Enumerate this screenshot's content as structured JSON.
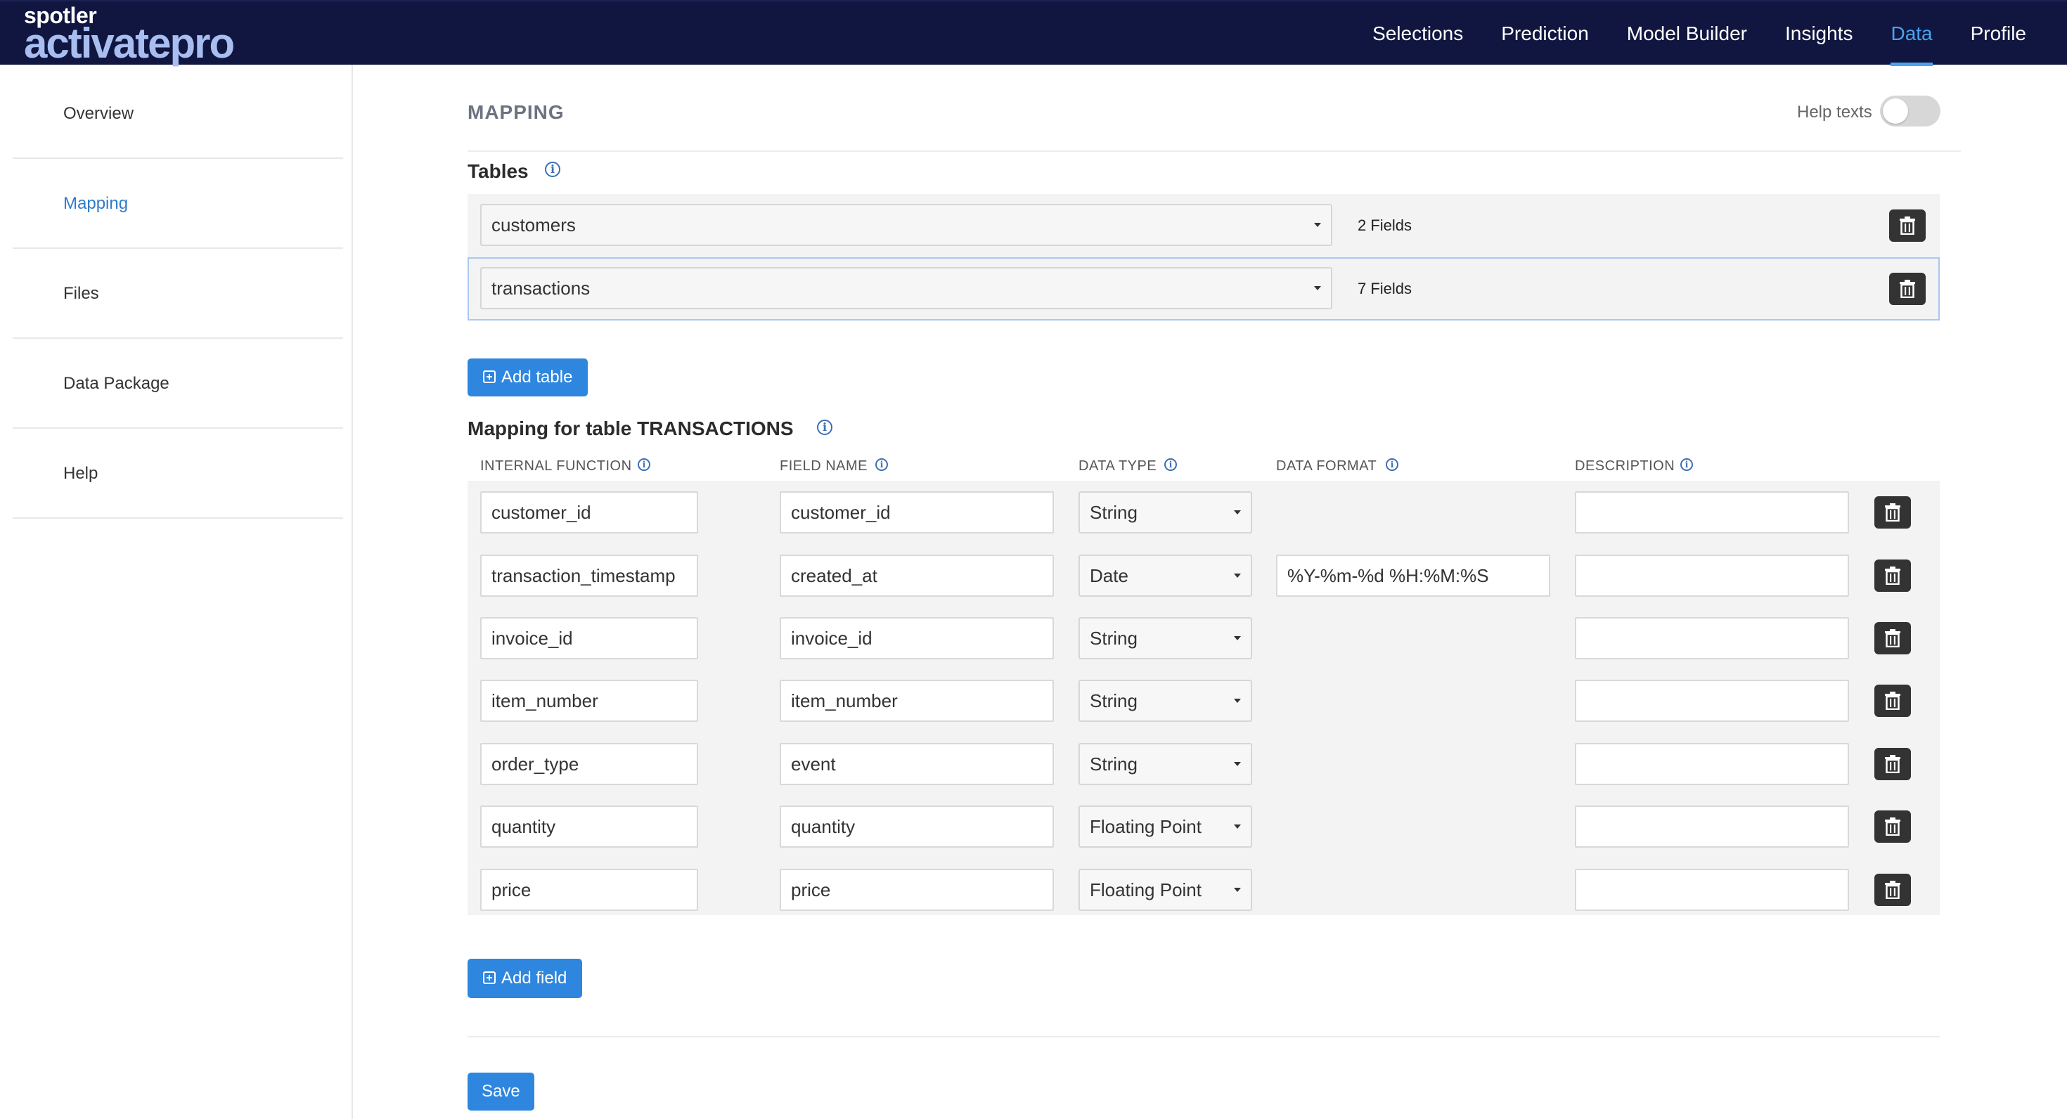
{
  "brand": {
    "top": "spotler",
    "name": "activatepro"
  },
  "nav": [
    {
      "label": "Selections",
      "active": false
    },
    {
      "label": "Prediction",
      "active": false
    },
    {
      "label": "Model Builder",
      "active": false
    },
    {
      "label": "Insights",
      "active": false
    },
    {
      "label": "Data",
      "active": true
    },
    {
      "label": "Profile",
      "active": false
    }
  ],
  "sidebar": [
    {
      "label": "Overview",
      "active": false
    },
    {
      "label": "Mapping",
      "active": true
    },
    {
      "label": "Files",
      "active": false
    },
    {
      "label": "Data Package",
      "active": false
    },
    {
      "label": "Help",
      "active": false
    }
  ],
  "page": {
    "title": "MAPPING",
    "help_texts_label": "Help texts",
    "help_texts_on": false
  },
  "tables_section": {
    "title": "Tables",
    "rows": [
      {
        "name": "customers",
        "fields": "2 Fields"
      },
      {
        "name": "transactions",
        "fields": "7 Fields",
        "selected": true
      }
    ],
    "add_label": "Add table"
  },
  "mapping_section": {
    "title": "Mapping for table TRANSACTIONS",
    "columns": [
      "INTERNAL FUNCTION",
      "FIELD NAME",
      "DATA TYPE",
      "DATA FORMAT",
      "DESCRIPTION"
    ],
    "rows": [
      {
        "internal": "customer_id",
        "field": "customer_id",
        "type": "String",
        "format": null,
        "description": ""
      },
      {
        "internal": "transaction_timestamp",
        "field": "created_at",
        "type": "Date",
        "format": "%Y-%m-%d %H:%M:%S",
        "description": ""
      },
      {
        "internal": "invoice_id",
        "field": "invoice_id",
        "type": "String",
        "format": null,
        "description": ""
      },
      {
        "internal": "item_number",
        "field": "item_number",
        "type": "String",
        "format": null,
        "description": ""
      },
      {
        "internal": "order_type",
        "field": "event",
        "type": "String",
        "format": null,
        "description": ""
      },
      {
        "internal": "quantity",
        "field": "quantity",
        "type": "Floating Point",
        "format": null,
        "description": ""
      },
      {
        "internal": "price",
        "field": "price",
        "type": "Floating Point",
        "format": null,
        "description": ""
      }
    ],
    "add_label": "Add field"
  },
  "save_label": "Save",
  "colors": {
    "topbar": "#10163f",
    "accent": "#4aa3ee",
    "button": "#2f86de",
    "panel": "#f3f3f3"
  }
}
